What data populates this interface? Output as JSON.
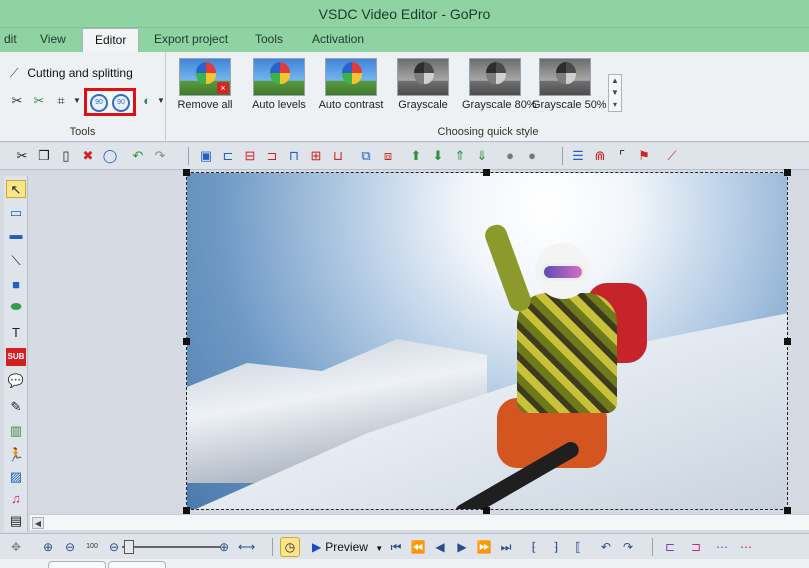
{
  "window": {
    "title": "VSDC Video Editor - GoPro"
  },
  "menu": {
    "tabs": [
      {
        "label": "dit",
        "active": false
      },
      {
        "label": "View",
        "active": false
      },
      {
        "label": "Editor",
        "active": true
      },
      {
        "label": "Export project",
        "active": false
      },
      {
        "label": "Tools",
        "active": false
      },
      {
        "label": "Activation",
        "active": false
      }
    ]
  },
  "ribbon": {
    "tools_group": {
      "cutting_label": "Cutting and splitting",
      "group_label": "Tools",
      "rotate_left_label": "90",
      "rotate_right_label": "90"
    },
    "quick_style_group": {
      "group_label": "Choosing quick style",
      "items": [
        {
          "label": "Remove all",
          "style": "color",
          "badge": "×"
        },
        {
          "label": "Auto levels",
          "style": "color"
        },
        {
          "label": "Auto contrast",
          "style": "color"
        },
        {
          "label": "Grayscale",
          "style": "gray"
        },
        {
          "label": "Grayscale 80%",
          "style": "gray"
        },
        {
          "label": "Grayscale 50%",
          "style": "gray"
        }
      ]
    }
  },
  "bottom": {
    "preview_label": "Preview",
    "zoom_reset_label": "100"
  },
  "colors": {
    "title_bar": "#8fd3a3",
    "highlight_box": "#e01010",
    "accent_blue": "#2f6fc7"
  }
}
